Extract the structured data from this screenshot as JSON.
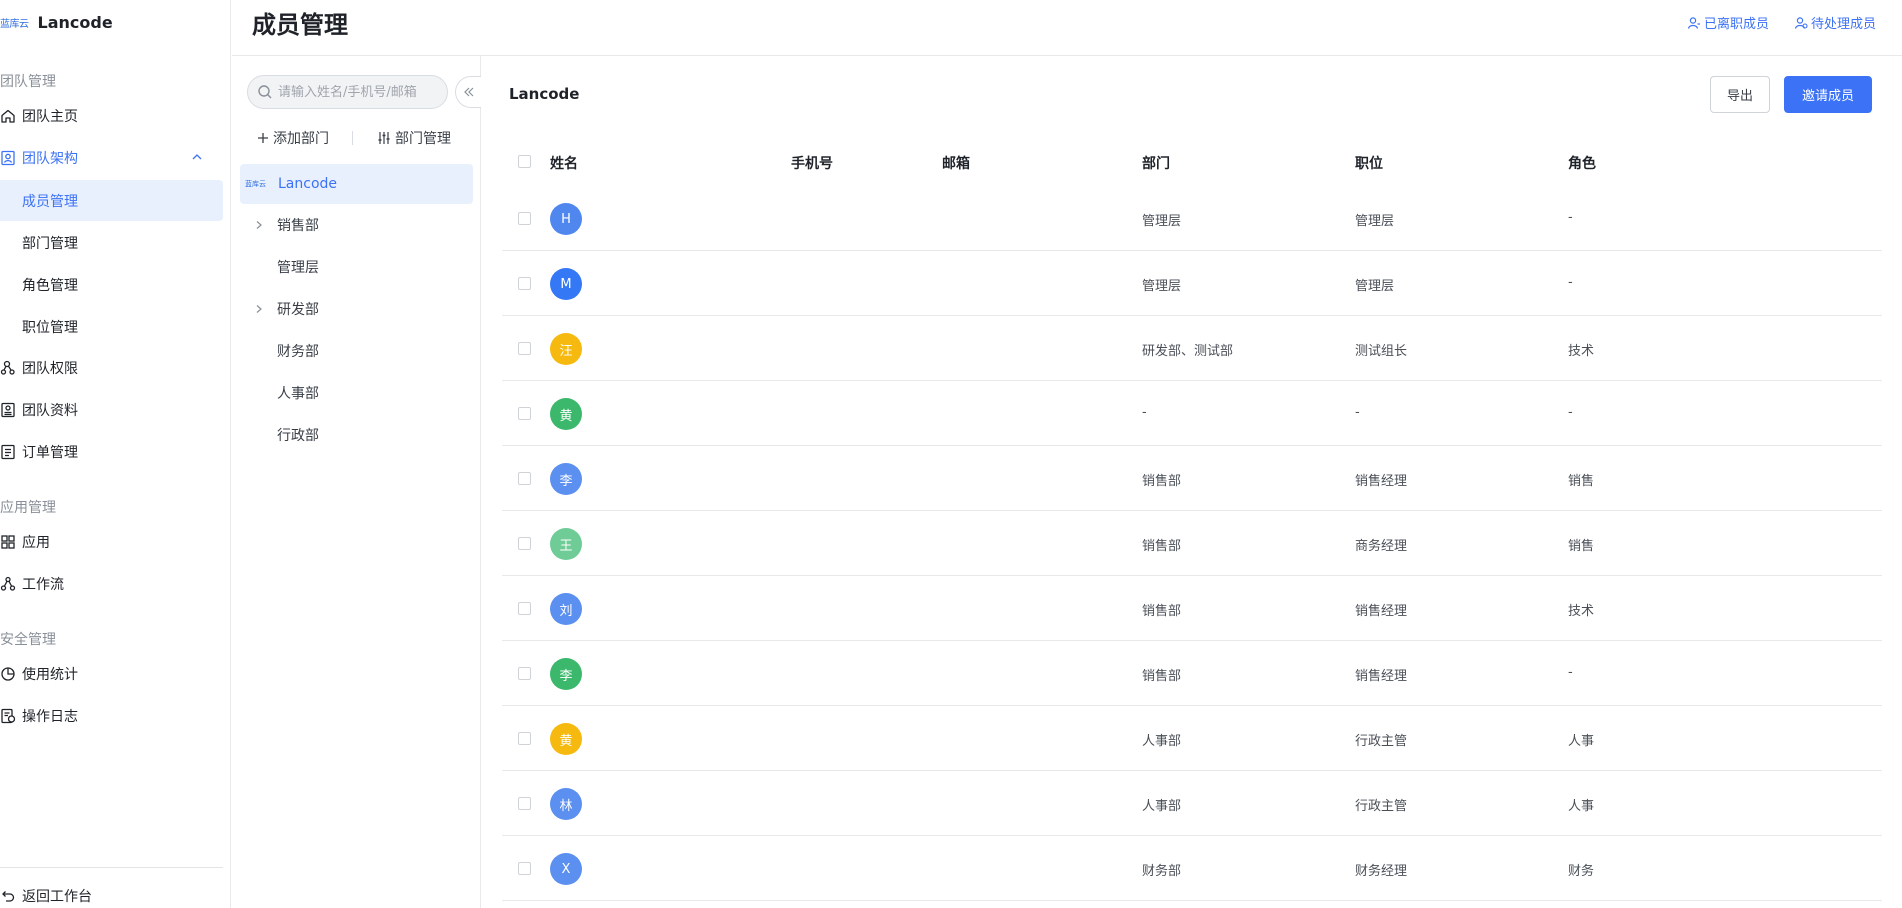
{
  "brand": {
    "logo_text": "蓝库云",
    "name": "Lancode"
  },
  "nav": {
    "group_team": "团队管理",
    "team_home": "团队主页",
    "team_structure": "团队架构",
    "sub_members": "成员管理",
    "sub_departments": "部门管理",
    "sub_roles": "角色管理",
    "sub_positions": "职位管理",
    "team_permissions": "团队权限",
    "team_info": "团队资料",
    "order_mgmt": "订单管理",
    "group_app": "应用管理",
    "apps": "应用",
    "workflow": "工作流",
    "group_security": "安全管理",
    "usage_stats": "使用统计",
    "operation_log": "操作日志",
    "back_workbench": "返回工作台"
  },
  "header": {
    "title": "成员管理",
    "resigned_link": "已离职成员",
    "pending_link": "待处理成员"
  },
  "dept_panel": {
    "search_placeholder": "请输入姓名/手机号/邮箱",
    "add_dept": "添加部门",
    "manage_dept": "部门管理",
    "root": {
      "logo_text": "蓝库云",
      "name": "Lancode"
    },
    "nodes": [
      {
        "label": "销售部",
        "has_children": true
      },
      {
        "label": "管理层",
        "has_children": false
      },
      {
        "label": "研发部",
        "has_children": true
      },
      {
        "label": "财务部",
        "has_children": false
      },
      {
        "label": "人事部",
        "has_children": false
      },
      {
        "label": "行政部",
        "has_children": false
      }
    ]
  },
  "main": {
    "org_name": "Lancode",
    "export_button": "导出",
    "invite_button": "邀请成员",
    "columns": {
      "name": "姓名",
      "phone": "手机号",
      "email": "邮箱",
      "dept": "部门",
      "position": "职位",
      "role": "角色"
    },
    "rows": [
      {
        "initial": "H",
        "color": "#4f87ef",
        "dept": "管理层",
        "position": "管理层",
        "role": "-"
      },
      {
        "initial": "M",
        "color": "#3478f6",
        "dept": "管理层",
        "position": "管理层",
        "role": "-"
      },
      {
        "initial": "汪",
        "color": "#f5b90f",
        "dept": "研发部、测试部",
        "position": "测试组长",
        "role": "技术"
      },
      {
        "initial": "黄",
        "color": "#3bb86b",
        "dept": "-",
        "position": "-",
        "role": "-"
      },
      {
        "initial": "李",
        "color": "#5b8ff0",
        "dept": "销售部",
        "position": "销售经理",
        "role": "销售"
      },
      {
        "initial": "王",
        "color": "#6fcc97",
        "dept": "销售部",
        "position": "商务经理",
        "role": "销售"
      },
      {
        "initial": "刘",
        "color": "#5b8ff0",
        "dept": "销售部",
        "position": "销售经理",
        "role": "技术"
      },
      {
        "initial": "李",
        "color": "#3bb86b",
        "dept": "销售部",
        "position": "销售经理",
        "role": "-"
      },
      {
        "initial": "黄",
        "color": "#f5b90f",
        "dept": "人事部",
        "position": "行政主管",
        "role": "人事"
      },
      {
        "initial": "林",
        "color": "#5b8ff0",
        "dept": "人事部",
        "position": "行政主管",
        "role": "人事"
      },
      {
        "initial": "X",
        "color": "#5b8ff0",
        "dept": "财务部",
        "position": "财务经理",
        "role": "财务"
      }
    ]
  },
  "colors": {
    "accent": "#3c72f5",
    "active_bg": "#e8effd",
    "border": "#e8e9eb"
  }
}
